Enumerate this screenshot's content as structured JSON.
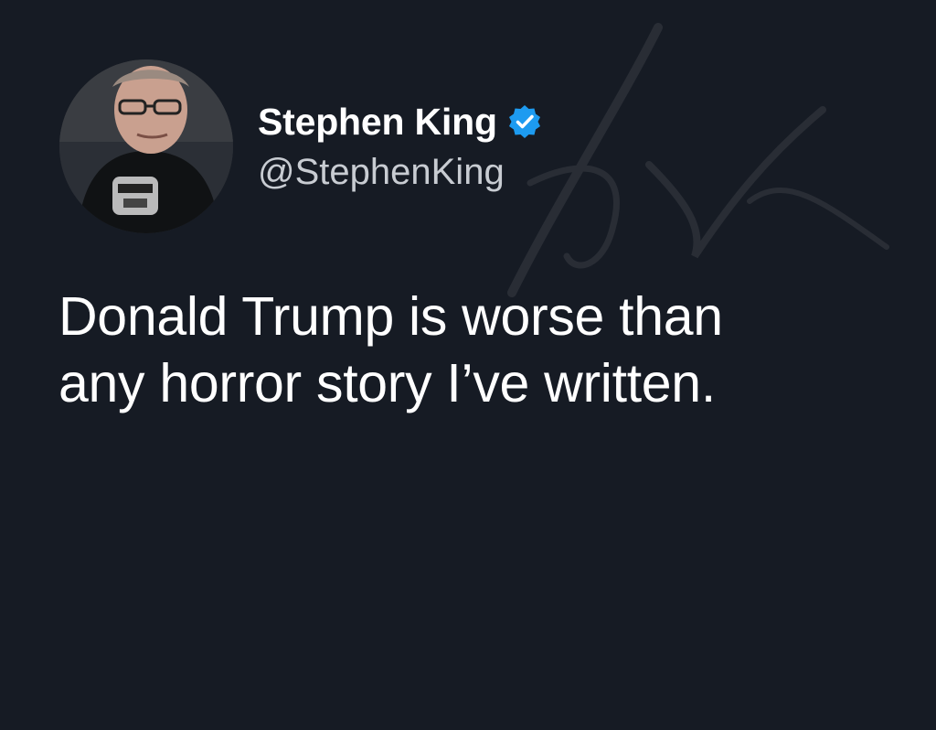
{
  "tweet": {
    "author": {
      "display_name": "Stephen King",
      "handle": "@StephenKing",
      "verified": true,
      "avatar": "author-photo"
    },
    "text_lines": [
      "Donald Trump is worse than",
      "any horror story I’ve written."
    ]
  },
  "colors": {
    "background": "#161b24",
    "text": "#ffffff",
    "handle": "#c8ccd2",
    "verified_badge": "#1d9bf0"
  },
  "icons": {
    "verified": "verified-badge-icon"
  }
}
